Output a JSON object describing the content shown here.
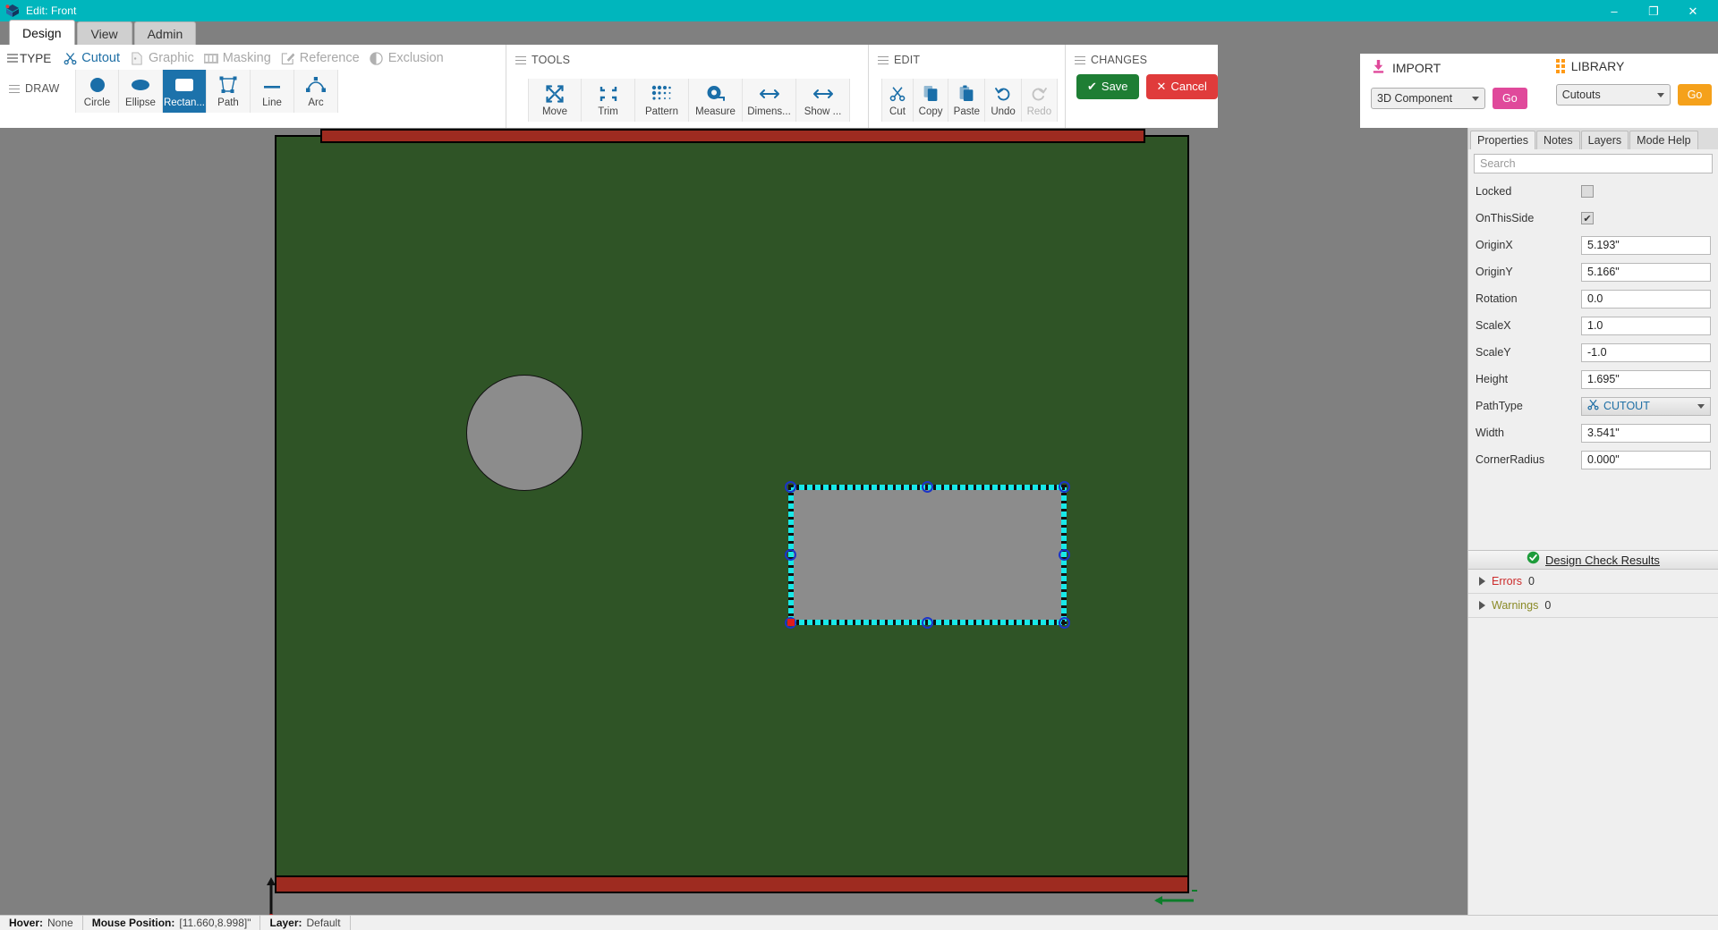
{
  "window": {
    "title": "Edit: Front",
    "icon": "app-logo-icon",
    "minimize": "–",
    "maximize": "❐",
    "close": "✕"
  },
  "ribbon": {
    "tabs": [
      {
        "label": "Design",
        "active": true
      },
      {
        "label": "View",
        "active": false
      },
      {
        "label": "Admin",
        "active": false
      }
    ],
    "type_group": {
      "label": "TYPE",
      "items": [
        {
          "label": "Cutout",
          "icon": "scissors-icon",
          "active": true
        },
        {
          "label": "Graphic",
          "icon": "image-file-icon",
          "active": false
        },
        {
          "label": "Masking",
          "icon": "masking-icon",
          "active": false
        },
        {
          "label": "Reference",
          "icon": "pencil-square-icon",
          "active": false
        },
        {
          "label": "Exclusion",
          "icon": "half-circle-icon",
          "active": false
        }
      ]
    },
    "draw_group": {
      "label": "DRAW",
      "items": [
        {
          "label": "Circle",
          "icon": "circle-icon",
          "selected": false
        },
        {
          "label": "Ellipse",
          "icon": "ellipse-icon",
          "selected": false
        },
        {
          "label": "Rectan...",
          "icon": "rectangle-icon",
          "selected": true
        },
        {
          "label": "Path",
          "icon": "path-icon",
          "selected": false
        },
        {
          "label": "Line",
          "icon": "line-icon",
          "selected": false
        },
        {
          "label": "Arc",
          "icon": "arc-icon",
          "selected": false
        }
      ]
    },
    "tools_group": {
      "label": "TOOLS",
      "items": [
        {
          "label": "Move",
          "icon": "move-arrows-icon"
        },
        {
          "label": "Trim",
          "icon": "trim-icon"
        },
        {
          "label": "Pattern",
          "icon": "pattern-dots-icon"
        },
        {
          "label": "Measure",
          "icon": "measure-tape-icon"
        },
        {
          "label": "Dimens...",
          "icon": "dimension-arrow-icon"
        },
        {
          "label": "Show ...",
          "icon": "show-arrow-icon"
        }
      ]
    },
    "edit_group": {
      "label": "EDIT",
      "items": [
        {
          "label": "Cut",
          "icon": "scissors-icon",
          "disabled": false
        },
        {
          "label": "Copy",
          "icon": "copy-icon",
          "disabled": false
        },
        {
          "label": "Paste",
          "icon": "paste-icon",
          "disabled": false
        },
        {
          "label": "Undo",
          "icon": "undo-icon",
          "disabled": false
        },
        {
          "label": "Redo",
          "icon": "redo-icon",
          "disabled": true
        }
      ]
    },
    "changes_group": {
      "label": "CHANGES",
      "save_label": "Save",
      "cancel_label": "Cancel",
      "save_color": "#1e7e34",
      "cancel_color": "#e03b3b"
    }
  },
  "io_panel": {
    "import": {
      "title": "IMPORT",
      "icon": "import-download-icon",
      "selected_option": "3D Component",
      "go_label": "Go",
      "go_color": "#e0499b"
    },
    "library": {
      "title": "LIBRARY",
      "icon": "library-grid-icon",
      "selected_option": "Cutouts",
      "go_label": "Go",
      "go_color": "#f5a11b"
    }
  },
  "right_panel": {
    "tabs": [
      {
        "label": "Properties",
        "active": true
      },
      {
        "label": "Notes",
        "active": false
      },
      {
        "label": "Layers",
        "active": false
      },
      {
        "label": "Mode Help",
        "active": false
      }
    ],
    "search_placeholder": "Search",
    "search_value": "",
    "properties": [
      {
        "label": "Locked",
        "type": "checkbox",
        "value": "",
        "checked": false
      },
      {
        "label": "OnThisSide",
        "type": "checkbox",
        "value": "✔",
        "checked": true
      },
      {
        "label": "OriginX",
        "type": "text",
        "value": "5.193\""
      },
      {
        "label": "OriginY",
        "type": "text",
        "value": "5.166\""
      },
      {
        "label": "Rotation",
        "type": "text",
        "value": "0.0"
      },
      {
        "label": "ScaleX",
        "type": "text",
        "value": "1.0"
      },
      {
        "label": "ScaleY",
        "type": "text",
        "value": "-1.0"
      },
      {
        "label": "Height",
        "type": "text",
        "value": "1.695\""
      },
      {
        "label": "PathType",
        "type": "select",
        "value": "CUTOUT",
        "icon": "scissors-icon"
      },
      {
        "label": "Width",
        "type": "text",
        "value": "3.541\""
      },
      {
        "label": "CornerRadius",
        "type": "text",
        "value": "0.000\""
      }
    ],
    "design_check": {
      "title": "Design Check Results",
      "icon": "check-circle-icon",
      "rows": [
        {
          "label": "Errors",
          "count": "0",
          "color": "#cc2b2b"
        },
        {
          "label": "Warnings",
          "count": "0",
          "color": "#8a8a26"
        }
      ]
    }
  },
  "canvas": {
    "board_color": "#2f5426",
    "rail_color": "#9e2b20",
    "hole_color": "#8c8c8c",
    "selection_color": "#18e8e8",
    "handle_color": "#1b34c8",
    "anchor_color": "#e01b1b"
  },
  "statusbar": {
    "hover_label": "Hover:",
    "hover_value": "None",
    "mouse_label": "Mouse Position:",
    "mouse_value": "[11.660,8.998]\"",
    "layer_label": "Layer:",
    "layer_value": "Default"
  }
}
